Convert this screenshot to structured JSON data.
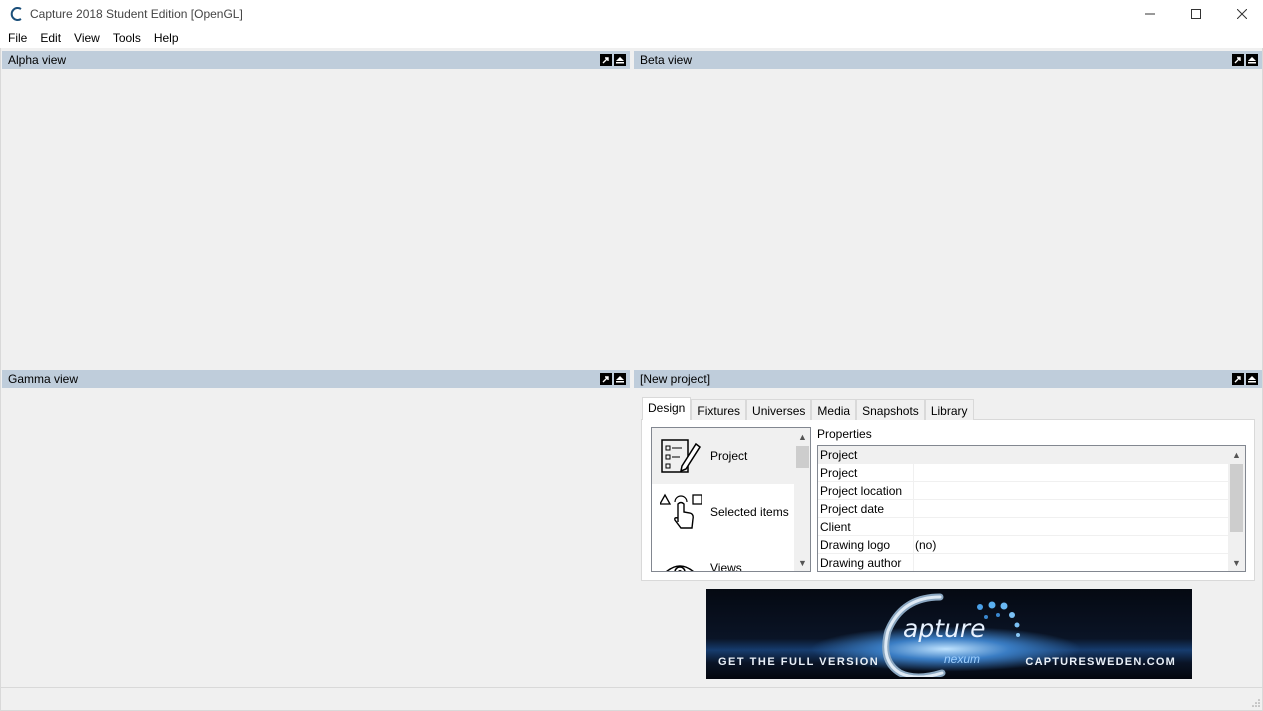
{
  "window": {
    "title": "Capture 2018 Student Edition  [OpenGL]"
  },
  "menu": [
    "File",
    "Edit",
    "View",
    "Tools",
    "Help"
  ],
  "panels": {
    "alpha": "Alpha view",
    "beta": "Beta view",
    "gamma": "Gamma view",
    "project": "[New project]"
  },
  "tabs": [
    "Design",
    "Fixtures",
    "Universes",
    "Media",
    "Snapshots",
    "Library"
  ],
  "active_tab": "Design",
  "categories": [
    {
      "label": "Project",
      "icon": "project-edit-icon",
      "selected": true
    },
    {
      "label": "Selected items",
      "icon": "selected-items-icon",
      "selected": false
    },
    {
      "label": "Views",
      "icon": "eye-icon",
      "selected": false
    }
  ],
  "properties": {
    "label": "Properties",
    "rows": [
      {
        "name": "Project",
        "value": "",
        "header": true
      },
      {
        "name": "Project",
        "value": ""
      },
      {
        "name": "Project location",
        "value": ""
      },
      {
        "name": "Project date",
        "value": ""
      },
      {
        "name": "Client",
        "value": ""
      },
      {
        "name": "Drawing logo",
        "value": "(no)"
      },
      {
        "name": "Drawing author",
        "value": ""
      }
    ]
  },
  "banner": {
    "left_text": "GET THE FULL VERSION",
    "logo_word": "apture",
    "logo_sub": "nexum",
    "right_text": "CAPTURESWEDEN.COM"
  }
}
